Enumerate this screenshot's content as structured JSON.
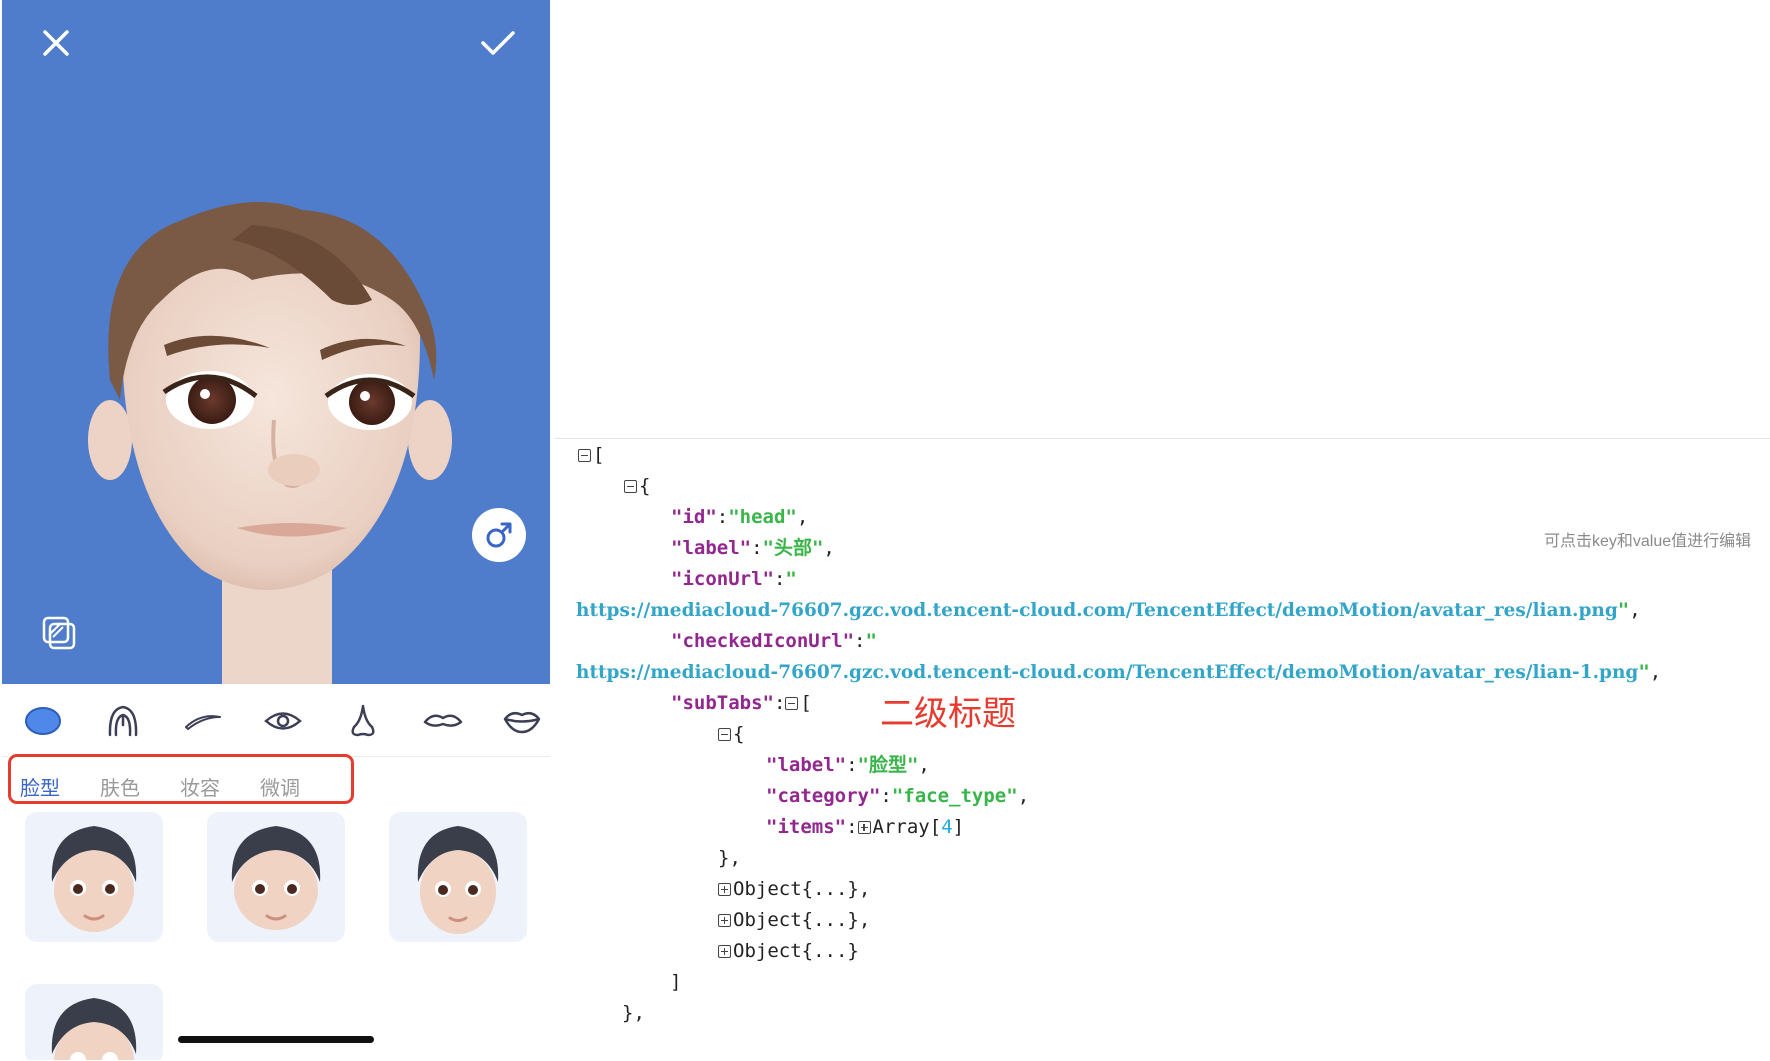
{
  "editor": {
    "category_icons": [
      "face-shape-icon",
      "hair-icon",
      "eyebrow-icon",
      "eye-icon",
      "nose-icon",
      "mustache-icon",
      "lips-icon"
    ],
    "sub_tabs": [
      {
        "label": "脸型",
        "active": true
      },
      {
        "label": "肤色",
        "active": false
      },
      {
        "label": "妆容",
        "active": false
      },
      {
        "label": "微调",
        "active": false
      }
    ],
    "items_visible": 4,
    "colors": {
      "preview_bg": "#4f7ccb",
      "accent": "#3a66c8",
      "highlight_box": "#e63b2e"
    }
  },
  "json_viewer": {
    "root_open": "[",
    "obj_open": "{",
    "id_key": "\"id\"",
    "id_val": "\"head\"",
    "label_key": "\"label\"",
    "label_val": "\"头部\"",
    "icon_key": "\"iconUrl\"",
    "quote": "\"",
    "icon_url": "https://mediacloud-76607.gzc.vod.tencent-cloud.com/TencentEffect/demoMotion/avatar_res/lian.png",
    "checked_key": "\"checkedIconUrl\"",
    "checked_url": "https://mediacloud-76607.gzc.vod.tencent-cloud.com/TencentEffect/demoMotion/avatar_res/lian-1.png",
    "subtabs_key": "\"subTabs\"",
    "sub_label_key": "\"label\"",
    "sub_label_val": "\"脸型\"",
    "category_key": "\"category\"",
    "category_val": "\"face_type\"",
    "items_key": "\"items\"",
    "items_type": "Array",
    "items_count": "4",
    "collapsed_object": "Object{...}",
    "close_bracket": "]",
    "close_obj": "},",
    "hint": "可点击key和value值进行编辑",
    "annotation": "二级标题"
  }
}
